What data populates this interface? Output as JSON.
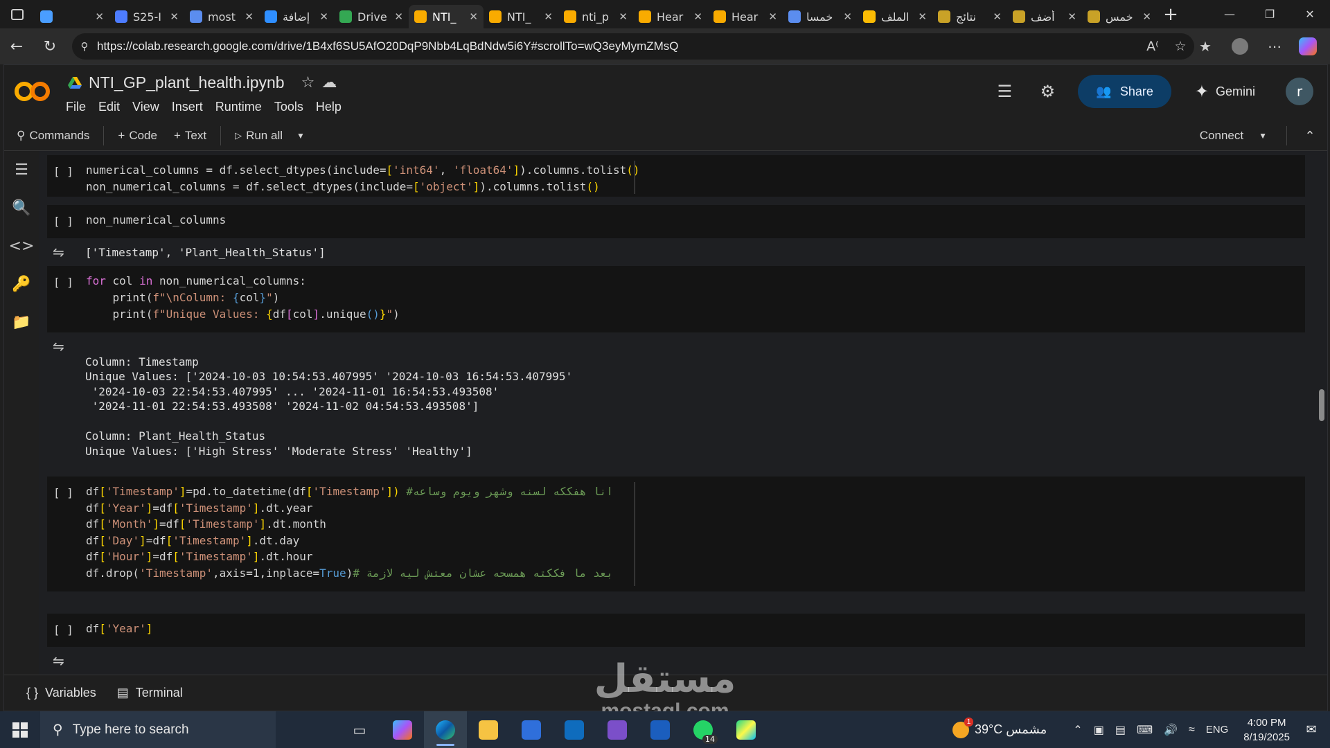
{
  "browser": {
    "tabs": [
      {
        "label": "",
        "color": "#4a9eff",
        "active": false
      },
      {
        "label": "S25-I",
        "color": "#4d7cff",
        "active": false
      },
      {
        "label": "most",
        "color": "#5b8def",
        "active": false
      },
      {
        "label": "إضافة",
        "color": "#2f8fff",
        "active": false
      },
      {
        "label": "Drive",
        "color": "#34a853",
        "active": false
      },
      {
        "label": "NTI_",
        "color": "#f9ab00",
        "active": true
      },
      {
        "label": "NTI_",
        "color": "#f9ab00",
        "active": false
      },
      {
        "label": "nti_p",
        "color": "#f9ab00",
        "active": false
      },
      {
        "label": "Hear",
        "color": "#f9ab00",
        "active": false
      },
      {
        "label": "Hear",
        "color": "#f9ab00",
        "active": false
      },
      {
        "label": "خمسا",
        "color": "#5b8def",
        "active": false
      },
      {
        "label": "الملف",
        "color": "#fbbc04",
        "active": false
      },
      {
        "label": "نتائج",
        "color": "#c9a227",
        "active": false
      },
      {
        "label": "أضف",
        "color": "#c9a227",
        "active": false
      },
      {
        "label": "خمس",
        "color": "#c9a227",
        "active": false
      }
    ],
    "url": "https://colab.research.google.com/drive/1B4xf6SU5AfO20DqP9Nbb4LqBdNdw5i6Y#scrollTo=wQ3eyMymZMsQ"
  },
  "colab": {
    "filename": "NTI_GP_plant_health.ipynb",
    "menu": [
      "File",
      "Edit",
      "View",
      "Insert",
      "Runtime",
      "Tools",
      "Help"
    ],
    "share_label": "Share",
    "gemini_label": "Gemini",
    "user_initial": "r",
    "toolbar": {
      "commands": "Commands",
      "code": "Code",
      "text": "Text",
      "run_all": "Run all",
      "connect": "Connect"
    },
    "run_marker": "[ ]",
    "bottom": {
      "variables": "Variables",
      "terminal": "Terminal"
    }
  },
  "cells": {
    "c1": {
      "l1": [
        "numerical_columns = df.select_dtypes(include=",
        "[",
        "'int64'",
        ", ",
        "'float64'",
        "]",
        ").columns.tolist",
        "()"
      ],
      "l2": [
        "non_numerical_columns = df.select_dtypes(include=",
        "[",
        "'object'",
        "]",
        ").columns.tolist",
        "()"
      ]
    },
    "c2": {
      "code": "non_numerical_columns"
    },
    "o2": {
      "text": "['Timestamp', 'Plant_Health_Status']"
    },
    "c3": {
      "l1": [
        "for",
        " col ",
        "in",
        " non_numerical_columns:"
      ],
      "l2": [
        "    print(",
        "f\"\\nColumn: ",
        "{",
        "col",
        "}",
        "\"",
        ")"
      ],
      "l3": [
        "    print(",
        "f\"Unique Values: ",
        "{",
        "df",
        "[",
        "col",
        "]",
        ".unique",
        "()",
        "}",
        "\"",
        ")"
      ]
    },
    "o3": {
      "lines": [
        "",
        "Column: Timestamp",
        "Unique Values: ['2024-10-03 10:54:53.407995' '2024-10-03 16:54:53.407995'",
        " '2024-10-03 22:54:53.407995' ... '2024-11-01 16:54:53.493508'",
        " '2024-11-01 22:54:53.493508' '2024-11-02 04:54:53.493508']",
        "",
        "Column: Plant_Health_Status",
        "Unique Values: ['High Stress' 'Moderate Stress' 'Healthy']"
      ]
    },
    "c4": {
      "l1": [
        "df",
        "[",
        "'Timestamp'",
        "]",
        "=pd.to_datetime(df",
        "[",
        "'Timestamp'",
        "]",
        ")",
        " #انا هفككه لسنه وشهر ويوم وساعه"
      ],
      "l2": [
        "df",
        "[",
        "'Year'",
        "]",
        "=df",
        "[",
        "'Timestamp'",
        "]",
        ".dt.year"
      ],
      "l3": [
        "df",
        "[",
        "'Month'",
        "]",
        "=df",
        "[",
        "'Timestamp'",
        "]",
        ".dt.month"
      ],
      "l4": [
        "df",
        "[",
        "'Day'",
        "]",
        "=df",
        "[",
        "'Timestamp'",
        "]",
        ".dt.day"
      ],
      "l5": [
        "df",
        "[",
        "'Hour'",
        "]",
        "=df",
        "[",
        "'Timestamp'",
        "]",
        ".dt.hour"
      ],
      "l6": [
        "df.drop(",
        "'Timestamp'",
        ",axis=1,inplace=",
        "True",
        ")",
        "# بعد ما فككته همسحه عشان معتش ليه لازمة"
      ]
    },
    "c5": {
      "l1": [
        "df",
        "[",
        "'Year'",
        "]"
      ]
    }
  },
  "watermark": {
    "arabic": "مستقل",
    "latin": "mostaql.com"
  },
  "taskbar": {
    "search_placeholder": "Type here to search",
    "weather": "39°C  مشمس",
    "weather_badge": "1",
    "lang": "ENG",
    "time": "4:00 PM",
    "date": "8/19/2025",
    "whatsapp_badge": "14"
  },
  "icons": {
    "colab_orange": "#f9ab00",
    "share_bg": "#0d3d66"
  }
}
